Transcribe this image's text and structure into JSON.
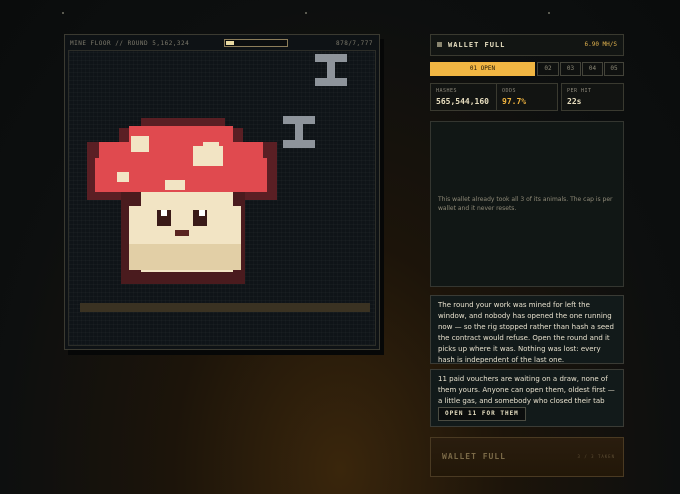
{
  "mine": {
    "title": "MINE FLOOR // ROUND 5,162,324",
    "count": "878/7,777",
    "progress": 0.13
  },
  "wallet": {
    "label": "WALLET FULL",
    "rate": "6.90 MH/S"
  },
  "tabs": [
    {
      "label": "01 OPEN",
      "active": true
    },
    {
      "label": "02",
      "active": false
    },
    {
      "label": "03",
      "active": false
    },
    {
      "label": "04",
      "active": false
    },
    {
      "label": "05",
      "active": false
    }
  ],
  "stats": [
    {
      "key": "HASHES",
      "value": "565,544,160"
    },
    {
      "key": "ODDS",
      "value": "97.7%"
    },
    {
      "key": "PER HIT",
      "value": "22s"
    }
  ],
  "info_text": "This wallet already took all 3 of its animals. The cap is per wallet and it never resets.",
  "notice": "The round your work was mined for left the window, and nobody has opened the one running now — so the rig stopped rather than hash a seed the contract would refuse. Open the round and it picks up where it was. Nothing was lost: every hash is independent of the last one.",
  "vouchers": {
    "text": "11 paid vouchers are waiting on a draw, none of them yours. Anyone can open them, oldest first — a little gas, and somebody who closed their tab gets their animal.",
    "button": "OPEN 11 FOR THEM"
  },
  "footer": {
    "title": "WALLET FULL",
    "taken": "3 / 3 TAKEN"
  },
  "colors": {
    "accent": "#f1b643",
    "mushroom_red": "#e04a4f",
    "cream": "#f2e4c4"
  }
}
